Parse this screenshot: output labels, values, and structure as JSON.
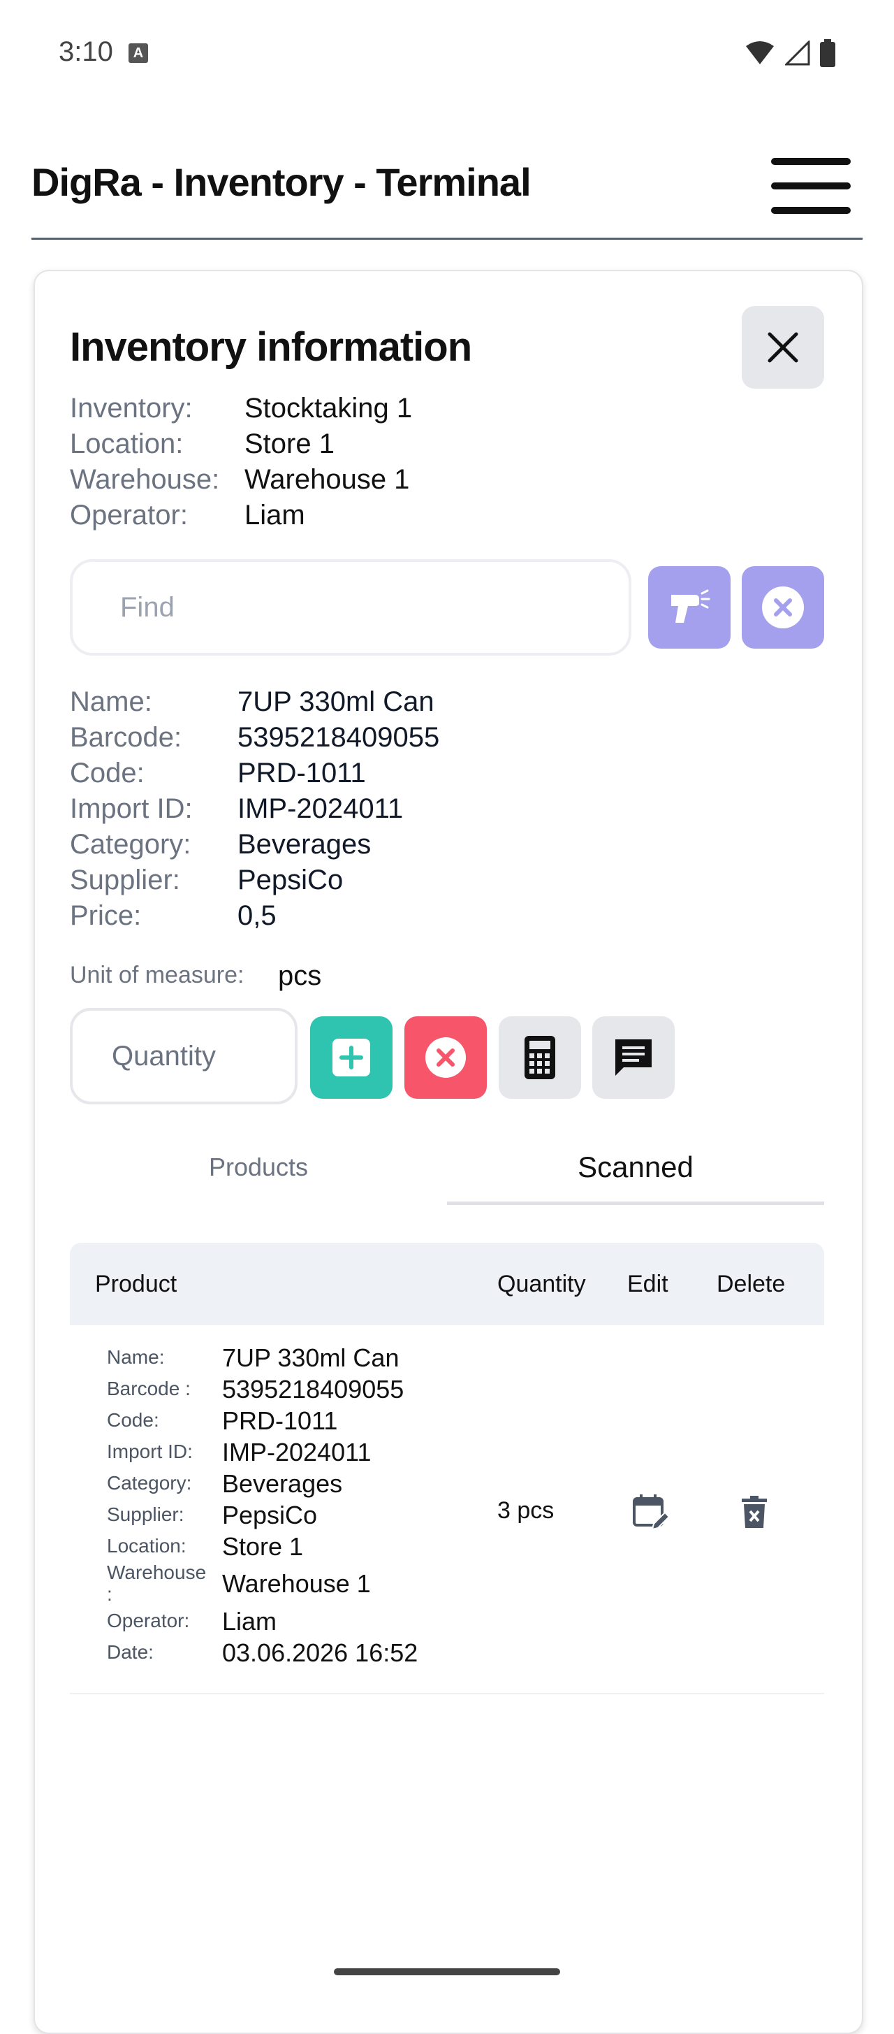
{
  "status_bar": {
    "time": "3:10",
    "notification_badge": "A"
  },
  "header": {
    "title": "DigRa - Inventory - Terminal"
  },
  "inventory_info": {
    "title": "Inventory information",
    "fields": [
      {
        "label": "Inventory:",
        "value": "Stocktaking 1"
      },
      {
        "label": "Location:",
        "value": "Store 1"
      },
      {
        "label": "Warehouse:",
        "value": "Warehouse 1"
      },
      {
        "label": "Operator:",
        "value": "Liam"
      }
    ]
  },
  "search": {
    "placeholder": "Find",
    "value": ""
  },
  "product": {
    "fields": [
      {
        "label": "Name:",
        "value": "7UP 330ml Can"
      },
      {
        "label": "Barcode:",
        "value": "5395218409055"
      },
      {
        "label": "Code:",
        "value": "PRD-1011"
      },
      {
        "label": "Import ID:",
        "value": "IMP-2024011"
      },
      {
        "label": "Category:",
        "value": "Beverages"
      },
      {
        "label": "Supplier:",
        "value": "PepsiCo"
      },
      {
        "label": "Price:",
        "value": "0,5"
      }
    ],
    "uom_label": "Unit of measure:",
    "uom_value": "pcs"
  },
  "quantity": {
    "placeholder": "Quantity",
    "value": ""
  },
  "tabs": [
    {
      "label": "Products",
      "active": false
    },
    {
      "label": "Scanned",
      "active": true
    }
  ],
  "table": {
    "headers": {
      "product": "Product",
      "quantity": "Quantity",
      "edit": "Edit",
      "delete": "Delete"
    },
    "rows": [
      {
        "fields": [
          {
            "label": "Name:",
            "value": "7UP 330ml Can"
          },
          {
            "label": "Barcode :",
            "value": "5395218409055"
          },
          {
            "label": "Code:",
            "value": "PRD-1011"
          },
          {
            "label": "Import ID:",
            "value": "IMP-2024011"
          },
          {
            "label": "Category:",
            "value": "Beverages"
          },
          {
            "label": "Supplier:",
            "value": "PepsiCo"
          },
          {
            "label": "Location:",
            "value": "Store 1"
          },
          {
            "label": "Warehouse :",
            "value": "Warehouse 1"
          },
          {
            "label": "Operator:",
            "value": "Liam"
          },
          {
            "label": "Date:",
            "value": "03.06.2026 16:52"
          }
        ],
        "quantity": "3 pcs"
      }
    ]
  },
  "colors": {
    "accent_purple": "#a5a0ee",
    "add_green": "#2ec4b0",
    "cancel_red": "#f7566a",
    "neutral_btn": "#e5e7eb"
  }
}
